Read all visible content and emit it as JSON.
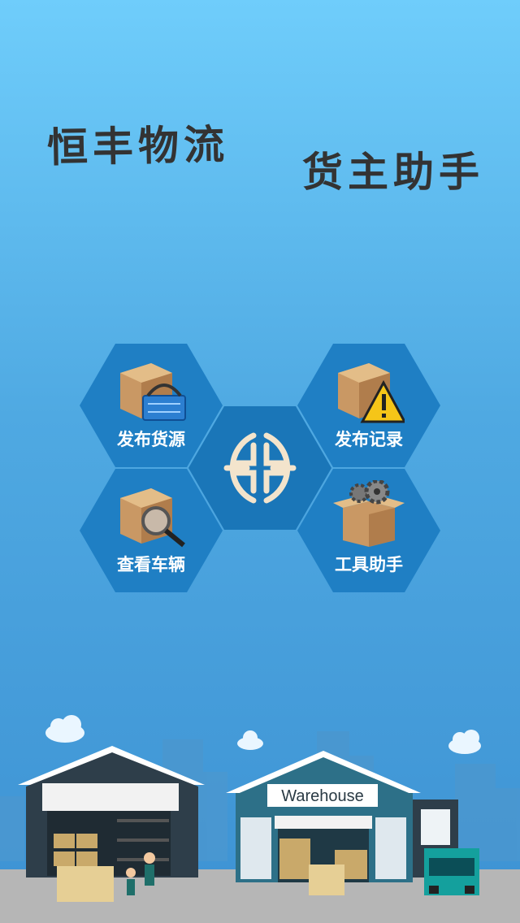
{
  "app": {
    "title_left": "恒丰物流",
    "title_right": "货主助手"
  },
  "menu": [
    {
      "label": "发布货源",
      "icon": "box-basket-icon"
    },
    {
      "label": "发布记录",
      "icon": "box-warning-icon"
    },
    {
      "label": "查看车辆",
      "icon": "box-magnifier-icon"
    },
    {
      "label": "工具助手",
      "icon": "box-gears-icon"
    }
  ],
  "scene": {
    "warehouse_sign": "Warehouse"
  },
  "colors": {
    "hex": "#1f7fc4",
    "center_hex": "#1a76b8",
    "logo": "#f3e4cc"
  }
}
